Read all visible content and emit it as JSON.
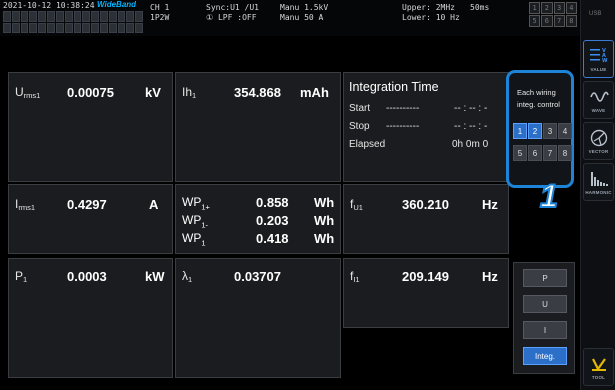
{
  "status": {
    "datetime": "2021-10-12 10:38:24",
    "wideband": "WideBand",
    "ch": "CH 1",
    "wiring": "1P2W",
    "sync_label": "Sync:U1 /U1",
    "lpf_label": "① LPF :OFF",
    "range_v": "Manu 1.5kV",
    "range_a": "Manu  50 A",
    "upper": "Upper:  2MHz",
    "lower": "Lower: 10 Hz",
    "rate": "50ms",
    "ch_numbers": [
      "1",
      "2",
      "3",
      "4",
      "5",
      "6",
      "7",
      "8"
    ]
  },
  "sidebar": {
    "value": "VALUE",
    "wave": "WAVE",
    "vector": "VECTOR",
    "harmonic": "HARMONIC",
    "tool": "TOOL",
    "usb": "USB"
  },
  "rows": {
    "r1": {
      "urms_label": "U",
      "urms_sub": "rms1",
      "urms_val": "0.00075",
      "urms_unit": "kV",
      "ih_label": "Ih",
      "ih_sub": "1",
      "ih_val": "354.868",
      "ih_unit": "mAh"
    },
    "r2": {
      "irms_label": "I",
      "irms_sub": "rms1",
      "irms_val": "0.4297",
      "irms_unit": "A",
      "wp": [
        {
          "label": "WP",
          "sub": "1+",
          "val": "0.858",
          "unit": "Wh"
        },
        {
          "label": "WP",
          "sub": "1-",
          "val": "0.203",
          "unit": "Wh"
        },
        {
          "label": "WP",
          "sub": "1",
          "val": "0.418",
          "unit": "Wh"
        }
      ],
      "fu_label": "f",
      "fu_sub": "U1",
      "fu_val": "360.210",
      "fu_unit": "Hz"
    },
    "r3": {
      "p_label": "P",
      "p_sub": "1",
      "p_val": "0.0003",
      "p_unit": "kW",
      "lam_label": "λ",
      "lam_sub": "1",
      "lam_val": "0.03707",
      "fi_label": "f",
      "fi_sub": "I1",
      "fi_val": "209.149",
      "fi_unit": "Hz"
    }
  },
  "integration": {
    "title": "Integration Time",
    "start": "Start",
    "stop": "Stop",
    "elapsed": "Elapsed",
    "dashes": "----------",
    "start_val": "-- : -- : -",
    "stop_val": "-- : -- : -",
    "elapsed_val": "0h  0m  0"
  },
  "wiring_popup": {
    "line1": "Each wiring",
    "line2": "integ. control",
    "buttons": [
      "1",
      "2",
      "3",
      "4",
      "5",
      "6",
      "7",
      "8"
    ],
    "selected": [
      "1",
      "2"
    ]
  },
  "callout": "1",
  "selector": {
    "items": [
      "P",
      "U",
      "I",
      "Integ."
    ],
    "selected": "Integ."
  },
  "colors": {
    "accent": "#1e84d8",
    "selected": "#2b6fc8",
    "panel": "#1a1c1f"
  }
}
